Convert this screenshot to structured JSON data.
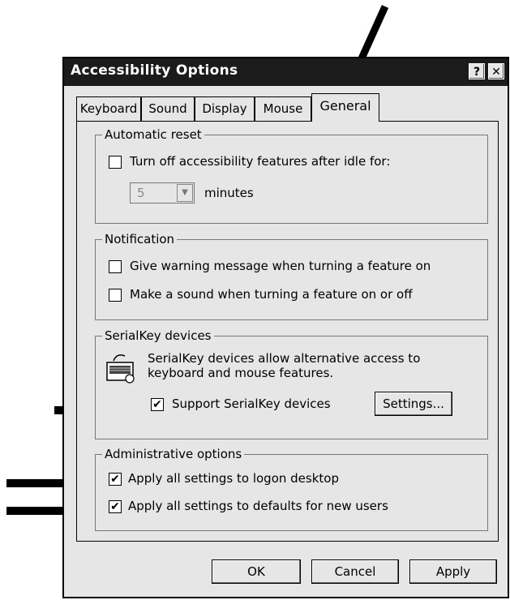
{
  "window": {
    "title": "Accessibility Options",
    "help_button": "?",
    "close_button": "✕"
  },
  "tabs": [
    {
      "label": "Keyboard",
      "active": false
    },
    {
      "label": "Sound",
      "active": false
    },
    {
      "label": "Display",
      "active": false
    },
    {
      "label": "Mouse",
      "active": false
    },
    {
      "label": "General",
      "active": true
    }
  ],
  "automatic_reset": {
    "legend": "Automatic reset",
    "turn_off_label": "Turn off accessibility features after idle for:",
    "turn_off_checked": false,
    "minutes_value": "5",
    "minutes_label": "minutes"
  },
  "notification": {
    "legend": "Notification",
    "warning_label": "Give warning message when turning a feature on",
    "warning_checked": false,
    "sound_label": "Make a sound when turning a feature on or off",
    "sound_checked": false
  },
  "serialkey": {
    "legend": "SerialKey devices",
    "description_line1": "SerialKey devices allow alternative access to",
    "description_line2": "keyboard and mouse features.",
    "support_label": "Support SerialKey devices",
    "support_checked": true,
    "settings_button": "Settings..."
  },
  "admin": {
    "legend": "Administrative options",
    "logon_label": "Apply all settings to logon desktop",
    "logon_checked": true,
    "defaults_label": "Apply all settings to defaults for new users",
    "defaults_checked": true
  },
  "footer": {
    "ok": "OK",
    "cancel": "Cancel",
    "apply": "Apply"
  },
  "check_glyph": "✔",
  "icons": {
    "serialkey": "keyboard-icon",
    "pointer": "arrow-icon"
  }
}
